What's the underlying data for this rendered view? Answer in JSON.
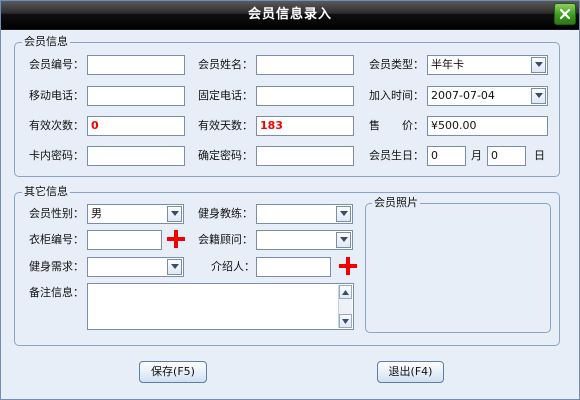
{
  "window": {
    "title": "会员信息录入"
  },
  "member_info": {
    "title": "会员信息",
    "labels": {
      "member_no": "会员编号：",
      "member_name": "会员姓名：",
      "member_type": "会员类型：",
      "mobile": "移动电话：",
      "landline": "固定电话：",
      "join_time": "加入时间：",
      "valid_count": "有效次数：",
      "valid_days": "有效天数：",
      "price": "售　　价：",
      "card_password": "卡内密码：",
      "confirm_password": "确定密码：",
      "birthday": "会员生日：",
      "month": "月",
      "day": "日"
    },
    "values": {
      "member_no": "",
      "member_name": "",
      "member_type": "半年卡",
      "mobile": "",
      "landline": "",
      "join_time": "2007-07-04",
      "valid_count": "0",
      "valid_days": "183",
      "price": "¥500.00",
      "card_password": "",
      "confirm_password": "",
      "birthday_month": "0",
      "birthday_day": "0"
    }
  },
  "other_info": {
    "title": "其它信息",
    "labels": {
      "gender": "会员性别：",
      "coach": "健身教练：",
      "locker_no": "衣柜编号：",
      "sales_advisor": "会籍顾问：",
      "fitness_needs": "健身需求：",
      "referrer": "介绍人：",
      "notes": "备注信息："
    },
    "values": {
      "gender": "男",
      "coach": "",
      "locker_no": "",
      "sales_advisor": "",
      "fitness_needs": "",
      "referrer": "",
      "notes": ""
    }
  },
  "photo": {
    "title": "会员照片"
  },
  "buttons": {
    "save": "保存(F5)",
    "exit": "退出(F4)"
  },
  "icons": {
    "close": "close-icon",
    "dropdown": "chevron-down-icon",
    "add": "plus-icon",
    "scroll_up": "chevron-up-icon",
    "scroll_down": "chevron-down-icon"
  },
  "colors": {
    "accent": "#3e9a1f",
    "error": "#f20000"
  }
}
